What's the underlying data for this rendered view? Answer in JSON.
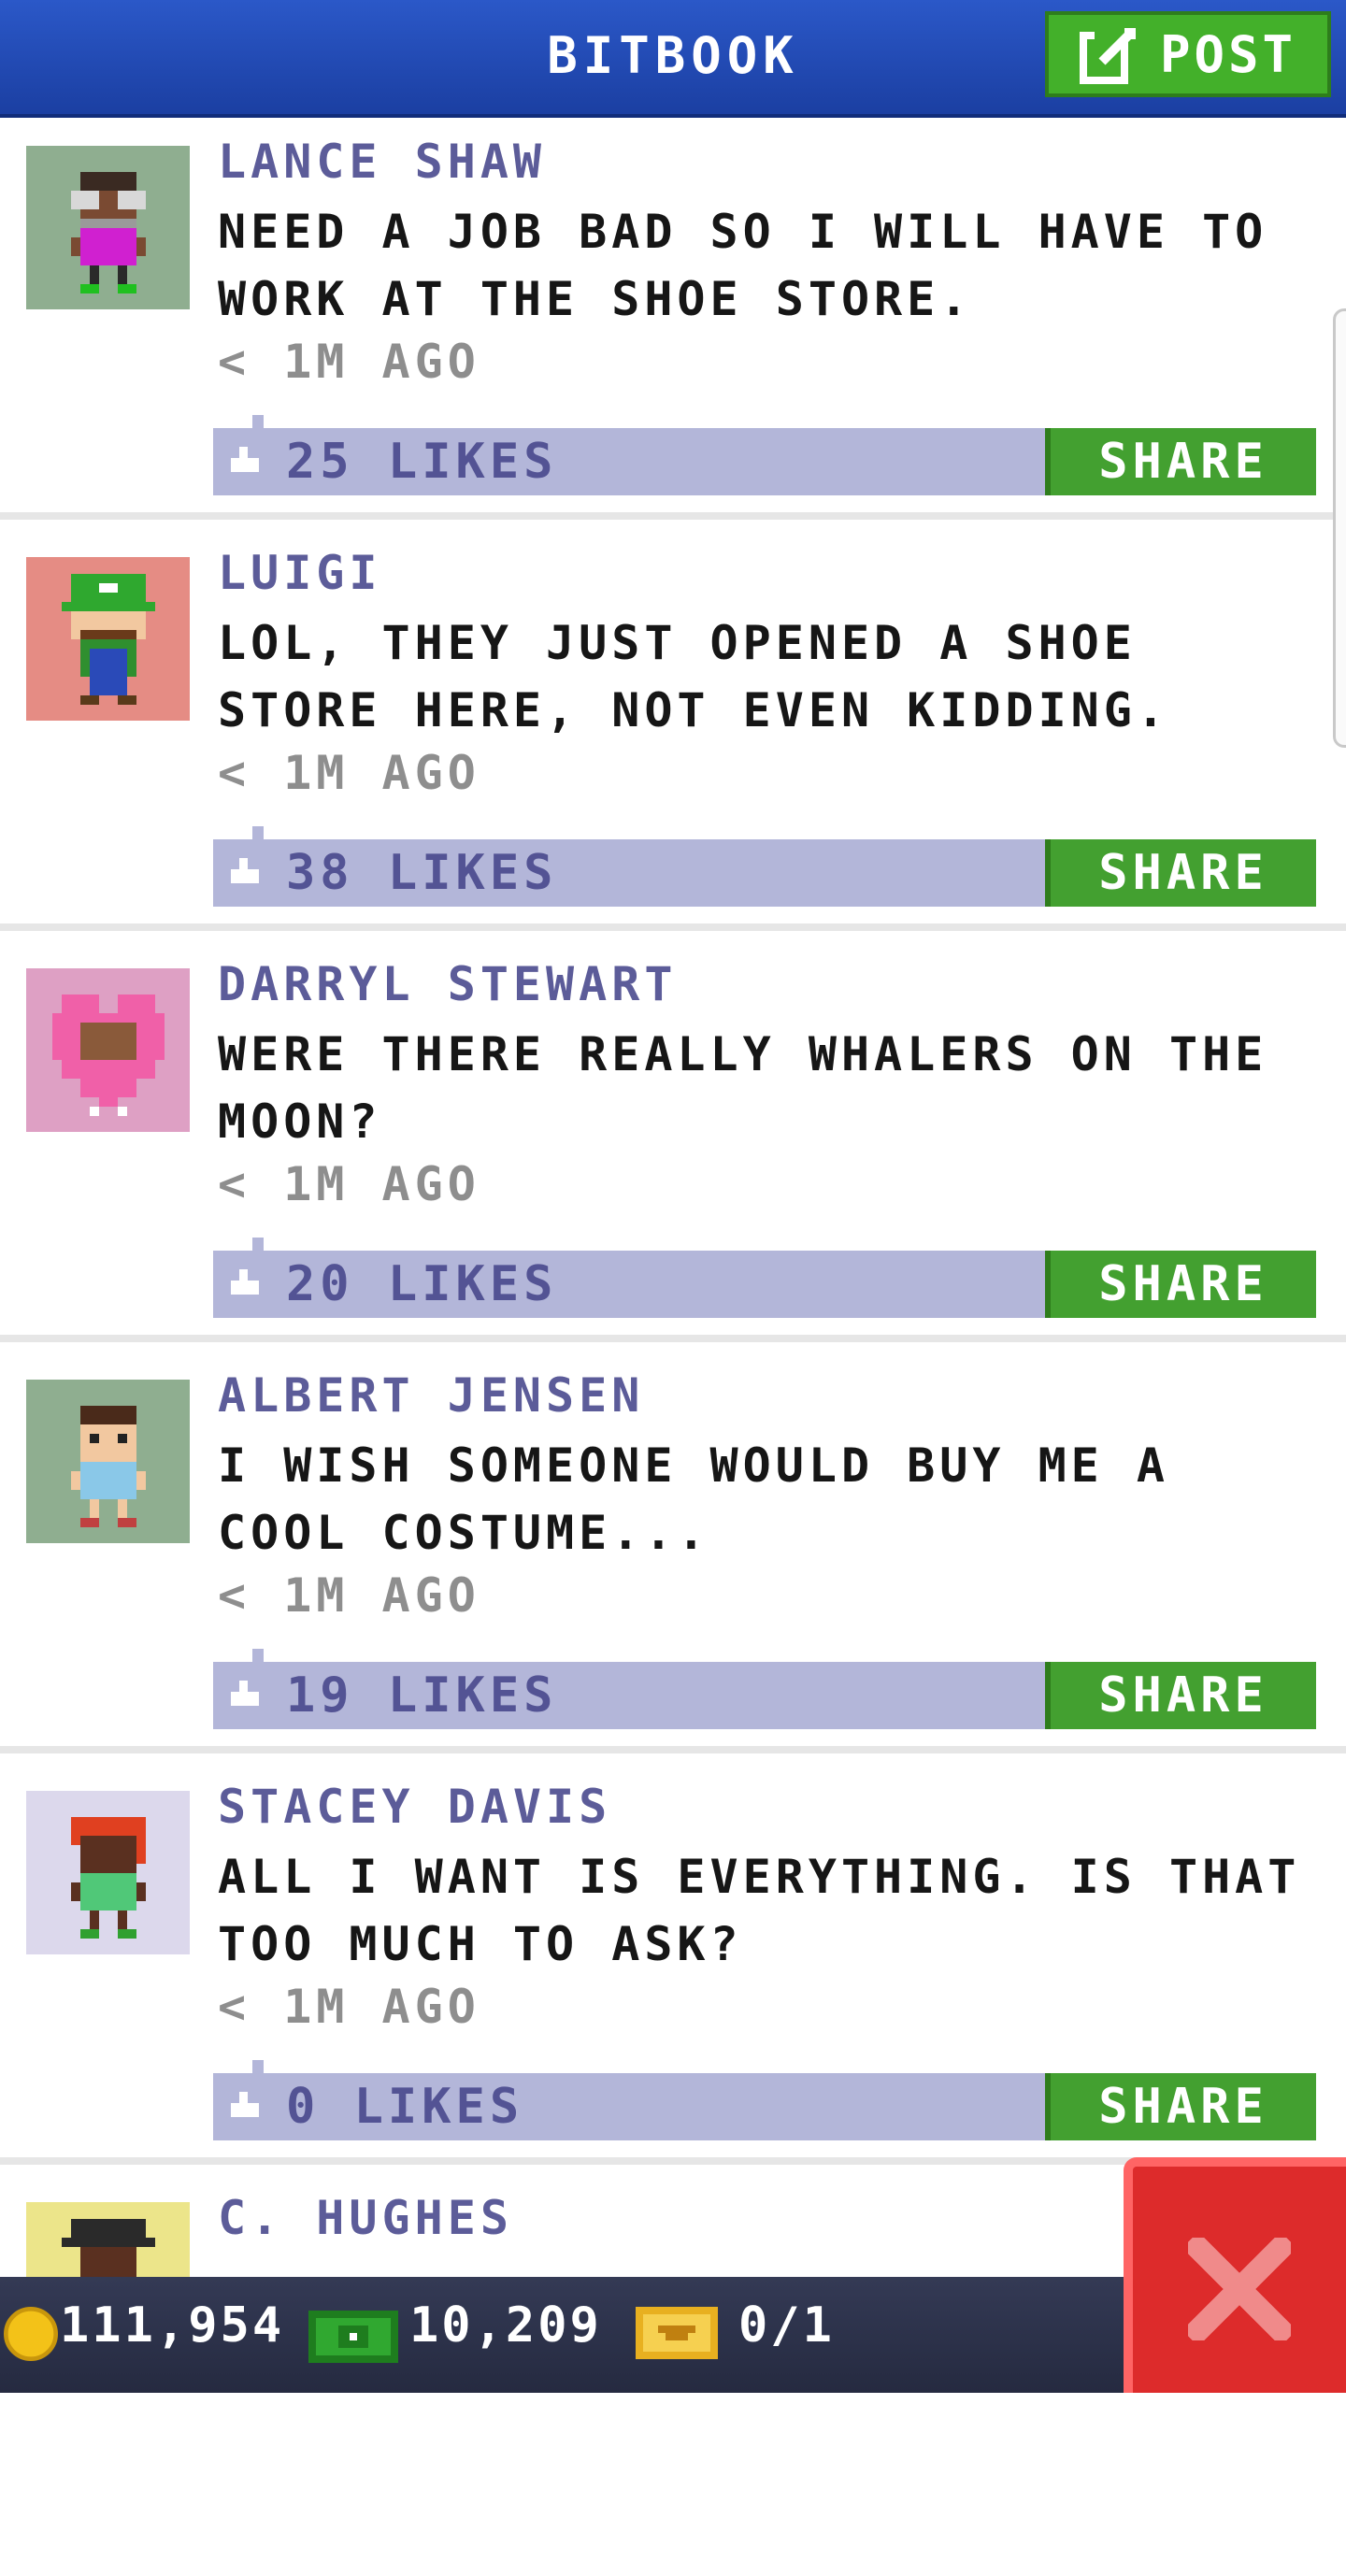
{
  "header": {
    "title": "BITBOOK",
    "post_label": "POST"
  },
  "posts": [
    {
      "author": "LANCE SHAW",
      "message": "NEED A JOB BAD SO I WILL HAVE TO WORK AT THE SHOE STORE.",
      "time": "< 1M AGO",
      "likes": "25 LIKES",
      "share_label": "SHARE",
      "avatar_bg": "#8fae90"
    },
    {
      "author": "LUIGI",
      "message": "LOL, THEY JUST OPENED A SHOE STORE HERE, NOT EVEN KIDDING.",
      "time": "< 1M AGO",
      "likes": "38 LIKES",
      "share_label": "SHARE",
      "avatar_bg": "#e58c84"
    },
    {
      "author": "DARRYL STEWART",
      "message": "WERE THERE REALLY WHALERS ON THE MOON?",
      "time": "< 1M AGO",
      "likes": "20 LIKES",
      "share_label": "SHARE",
      "avatar_bg": "#dea0c4"
    },
    {
      "author": "ALBERT JENSEN",
      "message": "I WISH SOMEONE WOULD BUY ME A COOL COSTUME...",
      "time": "< 1M AGO",
      "likes": "19 LIKES",
      "share_label": "SHARE",
      "avatar_bg": "#8fae90"
    },
    {
      "author": "STACEY DAVIS",
      "message": "ALL I WANT IS EVERYTHING. IS THAT TOO MUCH TO ASK?",
      "time": "< 1M AGO",
      "likes": "0 LIKES",
      "share_label": "SHARE",
      "avatar_bg": "#dcd8ec"
    },
    {
      "author": "C. HUGHES",
      "avatar_bg": "#ece58a"
    }
  ],
  "bottom_bar": {
    "coins": "111,954",
    "bux": "10,209",
    "tickets": "0/1"
  },
  "colors": {
    "header_blue": "#2b58c8",
    "share_green": "#43a030",
    "like_bar": "#b3b6d9",
    "close_red": "#dd2b2b"
  }
}
